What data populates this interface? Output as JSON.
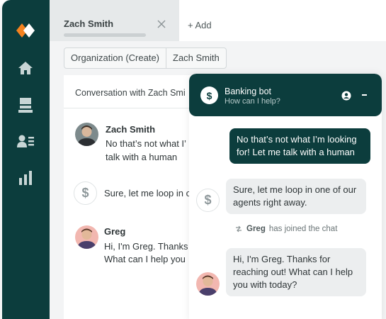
{
  "tab": {
    "title": "Zach Smith",
    "add_label": "+ Add"
  },
  "breadcrumb": [
    "Organization (Create)",
    "Zach Smith"
  ],
  "conversation": {
    "header": "Conversation with Zach Smi",
    "messages": [
      {
        "name": "Zach Smith",
        "lines": [
          "No that’s not what I’",
          "talk with a human"
        ]
      },
      {
        "name": "",
        "lines": [
          "Sure, let me loop in o"
        ]
      },
      {
        "name": "Greg",
        "lines": [
          "Hi, I'm Greg. Thanks",
          "What can I help you"
        ]
      }
    ]
  },
  "widget": {
    "title": "Banking bot",
    "subtitle": "How can I help?",
    "messages": {
      "user": [
        "No that’s not what I’m looking",
        "for! Let me talk with a human"
      ],
      "bot": [
        "Sure, let me loop in one of our",
        "agents right away."
      ],
      "joined_name": "Greg",
      "joined_text": "has joined the chat",
      "agent": [
        "Hi, I'm Greg. Thanks for",
        "reaching out! What can I help",
        "you with today?"
      ]
    }
  },
  "colors": {
    "brand_dark": "#0c3d3d",
    "logo_orange": "#f5821f"
  },
  "icons": [
    "logo-icon",
    "home-icon",
    "inbox-icon",
    "contacts-icon",
    "reports-icon",
    "close-icon",
    "dollar-icon",
    "user-icon",
    "minimize-icon",
    "join-icon"
  ]
}
